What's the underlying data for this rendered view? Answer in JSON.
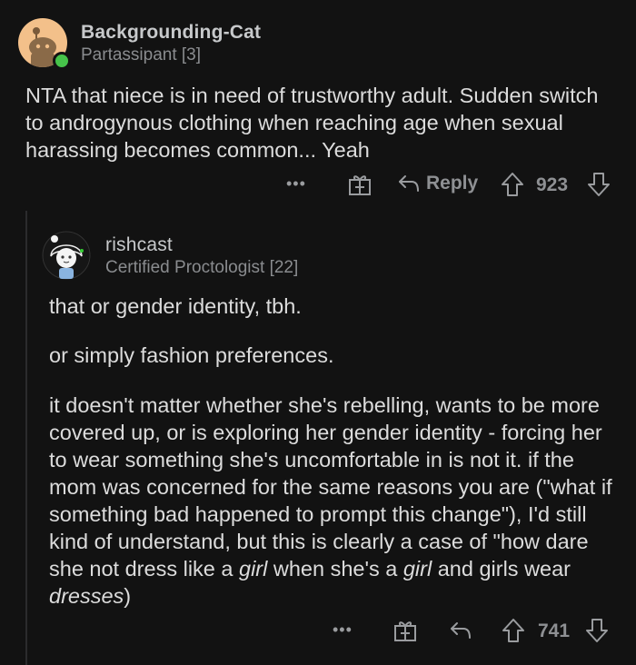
{
  "colors": {
    "background": "#121212",
    "text": "#dcdcdc",
    "muted": "#8e9093",
    "online": "#46c34a",
    "avatar_orange": "#f3c08a"
  },
  "comment": {
    "username": "Backgrounding-Cat",
    "flair": "Partassipant [3]",
    "body": "NTA that niece is in need of trustworthy adult. Sudden switch to androgynous clothing when reaching age when sexual harassing becomes common... Yeah",
    "more": "•••",
    "reply_label": "Reply",
    "score": "923"
  },
  "reply": {
    "username": "rishcast",
    "flair": "Certified Proctologist [22]",
    "paragraphs": {
      "p1": "that or gender identity, tbh.",
      "p2": "or simply fashion preferences.",
      "p3_a": "it doesn't matter whether she's rebelling, wants to be more covered up, or is exploring her gender identity - forcing her to wear something she's uncomfortable in is not it. if the mom was concerned for the same reasons you are (\"what if something bad happened to prompt this change\"), I'd still kind of understand, but this is clearly a case of \"how dare she not dress like a ",
      "p3_em1": "girl",
      "p3_b": " when she's a ",
      "p3_em2": "girl",
      "p3_c": " and girls wear ",
      "p3_em3": "dresses",
      "p3_d": ")"
    },
    "more": "•••",
    "score": "741"
  }
}
